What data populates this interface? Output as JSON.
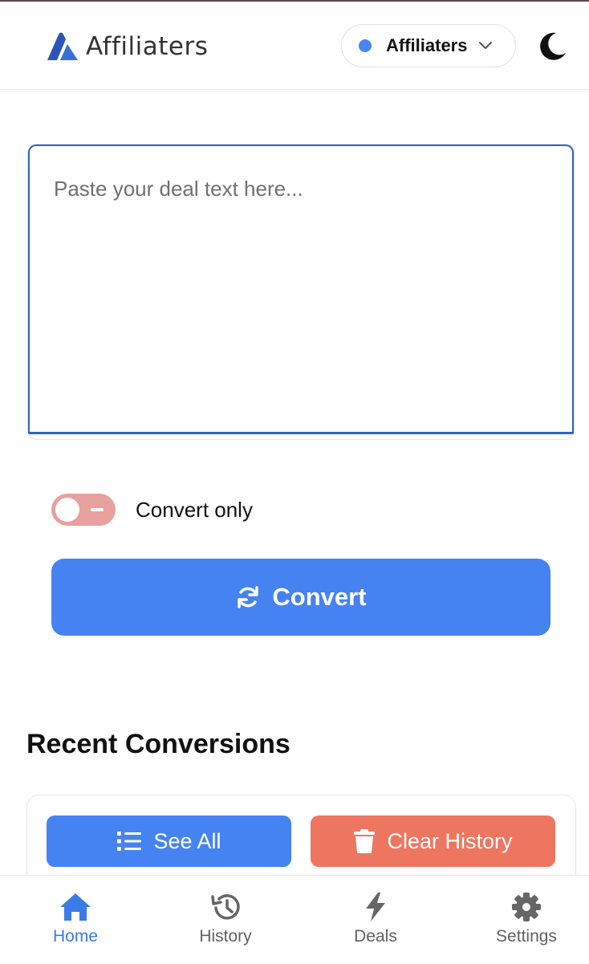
{
  "header": {
    "logo_text": "Affiliaters",
    "account_selector": {
      "label": "Affiliaters",
      "status_color": "#4a84f0"
    },
    "theme_icon": "moon-icon"
  },
  "composer": {
    "placeholder": "Paste your deal text here...",
    "value": ""
  },
  "toggle": {
    "label": "Convert only",
    "state": "off"
  },
  "convert_button": {
    "label": "Convert",
    "icon": "refresh-icon"
  },
  "recent": {
    "title": "Recent Conversions",
    "see_all_label": "See All",
    "see_all_icon": "list-icon",
    "clear_label": "Clear History",
    "clear_icon": "trash-icon"
  },
  "nav": {
    "items": [
      {
        "label": "Home",
        "icon": "home-icon",
        "active": true
      },
      {
        "label": "History",
        "icon": "history-icon",
        "active": false
      },
      {
        "label": "Deals",
        "icon": "bolt-icon",
        "active": false
      },
      {
        "label": "Settings",
        "icon": "gear-icon",
        "active": false
      }
    ]
  },
  "colors": {
    "primary": "#4683f2",
    "danger": "#ee7660",
    "toggle_off": "#e8a19e",
    "active_nav": "#3b7be6"
  }
}
